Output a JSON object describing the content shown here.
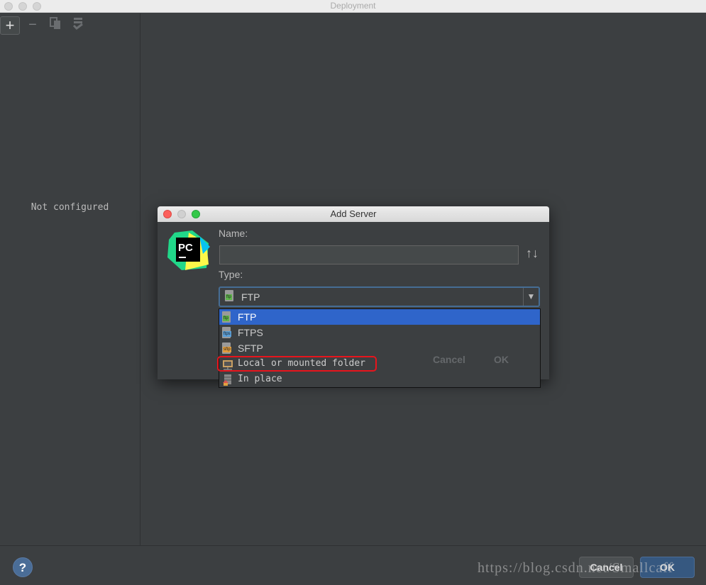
{
  "window": {
    "title": "Deployment"
  },
  "toolbar": {
    "add": "+",
    "remove": "−"
  },
  "left_panel": {
    "empty_text": "Not configured"
  },
  "footer": {
    "help": "?",
    "cancel": "Cancel",
    "ok": "OK"
  },
  "watermark": "https://blog.csdn.net/Smallcaff",
  "dialog": {
    "title": "Add Server",
    "name_label": "Name:",
    "name_value": "",
    "type_label": "Type:",
    "type_selected": "FTP",
    "sort_icon": "↑↓",
    "ghost_cancel": "Cancel",
    "ghost_ok": "OK",
    "type_options": [
      {
        "label": "FTP",
        "tag": "ftp",
        "color": "#5fb54b",
        "selected": true
      },
      {
        "label": "FTPS",
        "tag": "ftps",
        "color": "#5a9fd8"
      },
      {
        "label": "SFTP",
        "tag": "sftp",
        "color": "#e09c3c"
      },
      {
        "label": "Local or mounted folder",
        "icon": "folder-icon",
        "highlighted": true
      },
      {
        "label": "In place",
        "icon": "server-home-icon"
      }
    ]
  },
  "colors": {
    "selection": "#2f65ca",
    "highlight_box": "#e8141c",
    "background": "#3c3f41"
  }
}
